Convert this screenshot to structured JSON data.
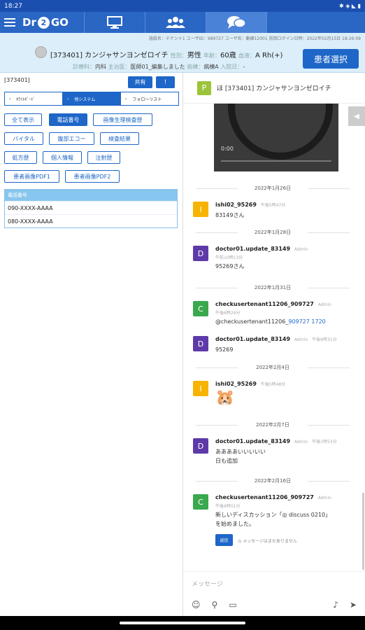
{
  "status": {
    "time": "18:27",
    "icons": "🗒 ◻ ✉",
    "right_icons": "✱ ◈ ◣ ▮"
  },
  "appbar": {
    "logo_left": "Dr",
    "logo_mid": "2",
    "logo_right": "GO"
  },
  "patient": {
    "meta": "施設名：テナント1  ユーザID：989727  ユーザ名：動確12001  前回ログイン日時：2022年02月15日 18:26:09",
    "id_name": "[373401] カンジャサンヨンゼロイチ",
    "sex_label": "性別：",
    "sex": "男性",
    "age_label": "年齢：",
    "age": "60歳",
    "blood_label": "血液：",
    "blood": "A Rh(+)",
    "dept_label": "診療科：",
    "dept": "内科",
    "doctor_label": "主治医：",
    "doctor": "医師01_編集しました",
    "ward_label": "病棟：",
    "ward": "病棟A",
    "adm_label": "入院日：",
    "adm": "-",
    "select_button": "患者選択"
  },
  "left": {
    "id": "[373401]",
    "share": "共有",
    "info": "!",
    "segments": [
      "ﾎﾜｲﾄﾎﾞｰﾄﾞ",
      "他システム",
      "フォローリスト"
    ],
    "chips": [
      "全て表示",
      "電話番号",
      "画像生理検査歴",
      "バイタル",
      "腹部エコー",
      "検査結果",
      "処方歴",
      "個人情報",
      "注射歴",
      "患者画像PDF1",
      "患者画像PDF2"
    ],
    "phone_header": "電話番号",
    "phones": [
      "090-XXXX-AAAA",
      "080-XXXX-AAAA"
    ]
  },
  "thread": {
    "avatar": "P",
    "title": "ほ [373401] カンジャサンヨンゼロイチ",
    "video_time": "0:00",
    "dates": [
      "2022年1月26日",
      "2022年1月28日",
      "2022年1月31日",
      "2022年2月4日",
      "2022年2月7日",
      "2022年2月16日"
    ],
    "messages": [
      {
        "avatar": "I",
        "name": "ishi02_95269",
        "role": "",
        "time": "午後5時47分",
        "text": "83149さん"
      },
      {
        "avatar": "D",
        "name": "doctor01.update_83149",
        "role": "Admin",
        "time": "午前10時13分",
        "text": "95269さん"
      },
      {
        "avatar": "C",
        "name": "checkusertenant11206_909727",
        "role": "Admin",
        "time": "午後6時29分",
        "text": "@checkusertenant11206_",
        "link": "909727 1720"
      },
      {
        "avatar": "D",
        "name": "doctor01.update_83149",
        "role": "Admin",
        "time": "午後6時31分",
        "text": "95269"
      },
      {
        "avatar": "I",
        "name": "ishi02_95269",
        "role": "",
        "time": "午後5時48分",
        "text": "🐹"
      },
      {
        "avatar": "D",
        "name": "doctor01.update_83149",
        "role": "Admin",
        "time": "午後1時53分",
        "text": "ああああいいいいい",
        "text2": "日も追加"
      },
      {
        "avatar": "C",
        "name": "checkusertenant11206_909727",
        "role": "Admin",
        "time": "午後6時01分",
        "text": "新しいディスカッション「◎ discuss 0210」",
        "text2": "を始めました。",
        "reply": "返信",
        "noreply": "メッセージはまだありません"
      }
    ],
    "composer_placeholder": "メッセージ"
  },
  "colors": {
    "brand": "#2a66c4",
    "accent": "#1e66c8",
    "avatar_I": "#f6b400",
    "avatar_D": "#5e3aa8",
    "avatar_C": "#3aa84e",
    "avatar_P": "#9bc43a"
  }
}
